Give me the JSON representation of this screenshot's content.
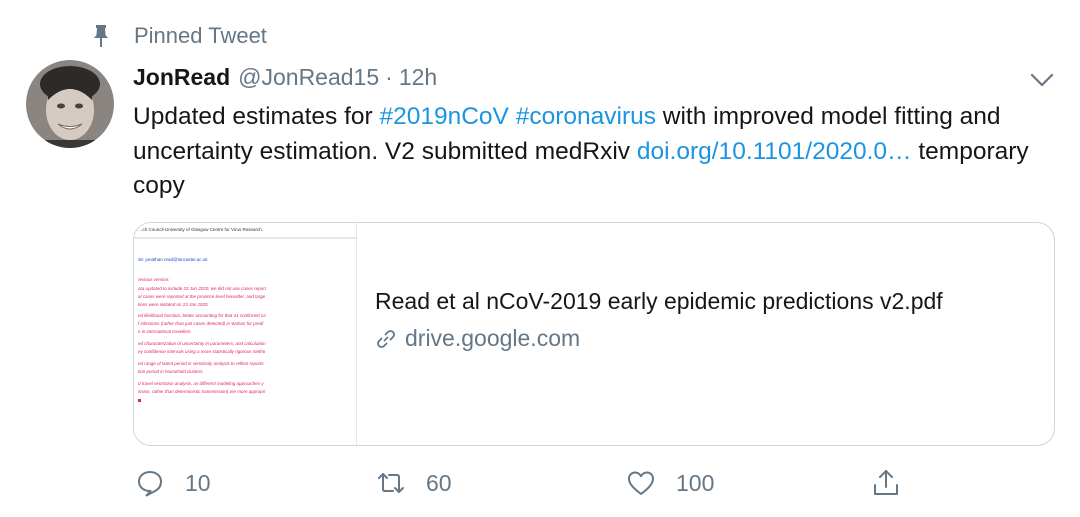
{
  "pinned": {
    "label": "Pinned Tweet",
    "icon": "pin-icon"
  },
  "author": {
    "name": "JonRead",
    "handle": "@JonRead15",
    "separator": "·",
    "time": "12h"
  },
  "tweet": {
    "text_parts": [
      {
        "text": "Updated estimates for ",
        "link": false
      },
      {
        "text": "#2019nCoV",
        "link": true
      },
      {
        "text": " ",
        "link": false
      },
      {
        "text": "#coronavirus",
        "link": true
      },
      {
        "text": " with improved model fitting and uncertainty estimation. V2 submitted medRxiv ",
        "link": false
      },
      {
        "text": "doi.org/10.1101/2020.0…",
        "link": true
      },
      {
        "text": " temporary copy",
        "link": false
      }
    ]
  },
  "card": {
    "title": "Read et al nCoV-2019 early epidemic predictions v2.pdf",
    "domain": "drive.google.com",
    "thumb_lines": [
      "…ch Council-University of Glasgow Centre for Virus Research,",
      "de: jonathan.read@lancaster.ac.uk",
      "revious version:",
      "ata updated to include 22 Jan 2020; we did not use cases report",
      "al cases were reported at the province level hereafter, and large",
      "tions were initiated on 23 Jan 2020.",
      "ed likelihood function, better accounting for that 41 confirmed ca",
      "f infections (rather than just cases detected) in Wuhan for predi",
      "n in international travellers.",
      "ed characterization of uncertainty in parameters, and calculation",
      "ey confidence intervals using a more statistically rigorous metho",
      "ed range of latent period in sensitivity analysis to reflect reports",
      "tion period in household clusters.",
      "d travel restriction analysis, as different modeling approaches y",
      "ission, rather than deterministic transmission) are more appropri"
    ]
  },
  "actions": {
    "reply": {
      "icon": "reply-icon",
      "count": "10"
    },
    "retweet": {
      "icon": "retweet-icon",
      "count": "60"
    },
    "like": {
      "icon": "heart-icon",
      "count": "100"
    },
    "share": {
      "icon": "share-icon"
    }
  },
  "colors": {
    "link": "#1b95e0",
    "secondary": "#657786",
    "primary": "#14171a",
    "border": "#ccd6dd",
    "thumb_text": "#e0245e"
  }
}
